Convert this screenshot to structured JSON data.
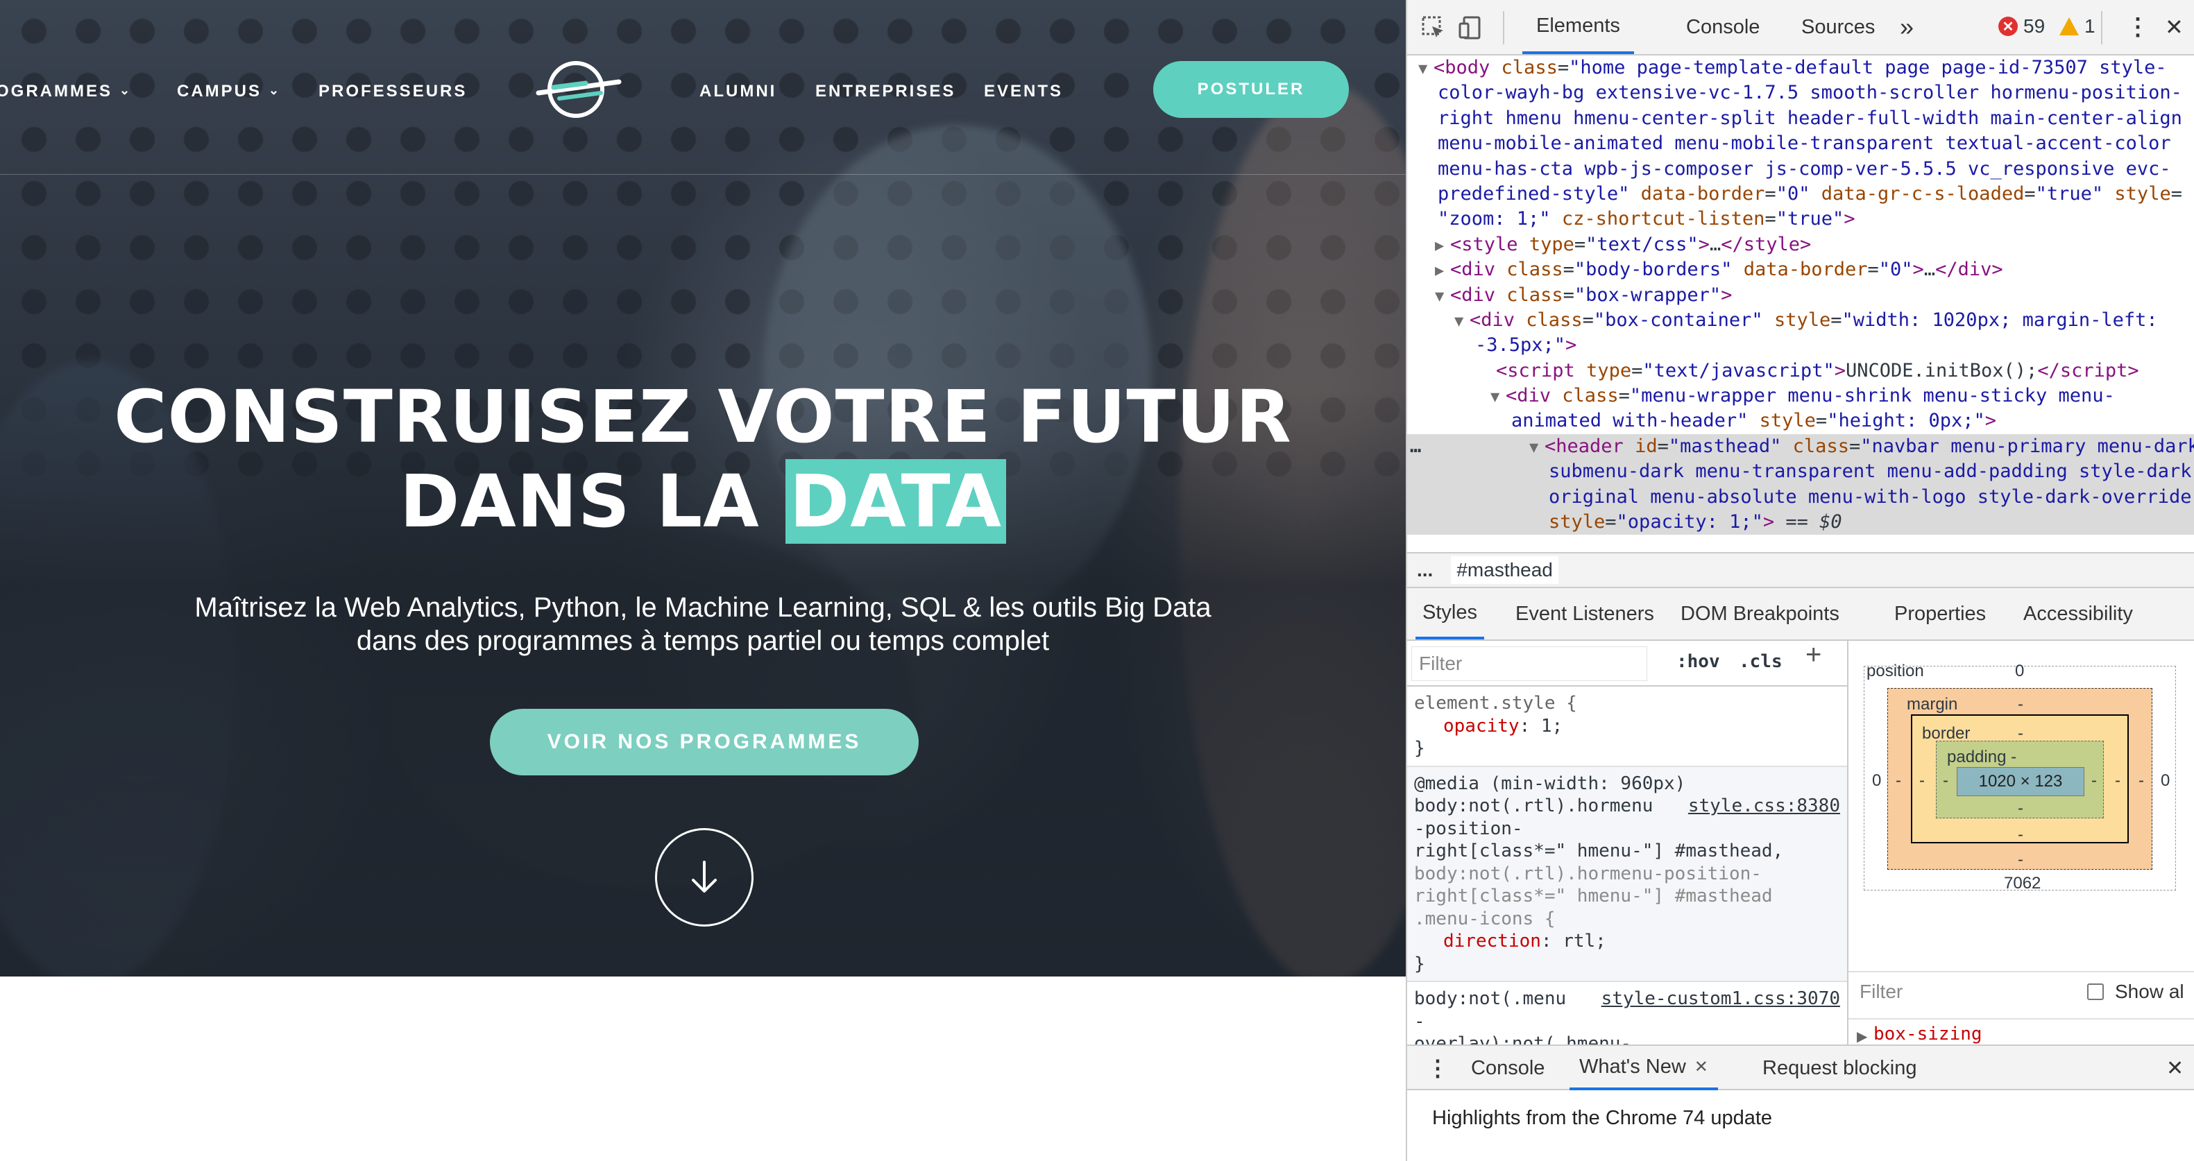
{
  "site": {
    "nav": {
      "items_left": [
        {
          "label": "OGRAMMES",
          "has_dropdown": true
        },
        {
          "label": "CAMPUS",
          "has_dropdown": true
        },
        {
          "label": "PROFESSEURS",
          "has_dropdown": false
        }
      ],
      "items_right": [
        {
          "label": "ALUMNI"
        },
        {
          "label": "ENTREPRISES"
        },
        {
          "label": "EVENTS"
        }
      ],
      "apply_label": "POSTULER",
      "chevron": "⌄"
    },
    "hero": {
      "title_line1": "CONSTRUISEZ VOTRE FUTUR",
      "title_line2_prefix": "DANS LA ",
      "title_line2_highlight": "DATA",
      "subtitle_line1": "Maîtrisez la Web Analytics, Python, le Machine Learning, SQL & les outils Big Data",
      "subtitle_line2": "dans des programmes à temps partiel ou temps complet",
      "cta_label": "VOIR NOS PROGRAMMES"
    },
    "colors": {
      "accent": "#5ed0c0",
      "cta": "#7dcfc0"
    }
  },
  "devtools": {
    "tabs": [
      "Elements",
      "Console",
      "Sources"
    ],
    "more_tabs": "»",
    "errors": "59",
    "warnings": "1",
    "error_icon": "✕",
    "menu_icon": "⋮",
    "close_icon": "✕",
    "dom_lines": [
      {
        "tri": "▼",
        "html": "<span class='tg'>&lt;body</span> <span class='an'>class</span>=<span class='av'>\"home page-template-default page page-id-73507 style-</span>"
      },
      {
        "tri": "",
        "html": "<span class='av'>color-wayh-bg extensive-vc-1.7.5 smooth-scroller hormenu-position-</span>"
      },
      {
        "tri": "",
        "html": "<span class='av'>right hmenu hmenu-center-split header-full-width main-center-align</span>"
      },
      {
        "tri": "",
        "html": "<span class='av'>menu-mobile-animated menu-mobile-transparent textual-accent-color</span>"
      },
      {
        "tri": "",
        "html": "<span class='av'>menu-has-cta wpb-js-composer js-comp-ver-5.5.5 vc_responsive evc-</span>"
      },
      {
        "tri": "",
        "html": "<span class='av'>predefined-style\"</span> <span class='an'>data-border</span>=<span class='av'>\"0\"</span> <span class='an'>data-gr-c-s-loaded</span>=<span class='av'>\"true\"</span> <span class='an'>style</span>=</span>"
      },
      {
        "tri": "",
        "html": "<span class='av'>\"zoom: 1;\"</span> <span class='an'>cz-shortcut-listen</span>=<span class='av'>\"true\"</span><span class='tg'>&gt;</span>"
      },
      {
        "tri": "▶",
        "html": "<span class='tg'>&lt;style</span> <span class='an'>type</span>=<span class='av'>\"text/css\"</span><span class='tg'>&gt;</span>…<span class='tg'>&lt;/style&gt;</span>"
      },
      {
        "tri": "▶",
        "html": "<span class='tg'>&lt;div</span> <span class='an'>class</span>=<span class='av'>\"body-borders\"</span> <span class='an'>data-border</span>=<span class='av'>\"0\"</span><span class='tg'>&gt;</span>…<span class='tg'>&lt;/div&gt;</span>"
      },
      {
        "tri": "▼",
        "html": "<span class='tg'>&lt;div</span> <span class='an'>class</span>=<span class='av'>\"box-wrapper\"</span><span class='tg'>&gt;</span>"
      },
      {
        "tri": "▼",
        "html": "<span class='tg'>&lt;div</span> <span class='an'>class</span>=<span class='av'>\"box-container\"</span> <span class='an'>style</span>=<span class='av'>\"width: 1020px; margin-left:</span>"
      },
      {
        "tri": "",
        "html": "<span class='av'>-3.5px;\"</span><span class='tg'>&gt;</span>"
      },
      {
        "tri": "",
        "html": "<span class='tg'>&lt;script</span> <span class='an'>type</span>=<span class='av'>\"text/javascript\"</span><span class='tg'>&gt;</span>UNCODE.initBox();<span class='tg'>&lt;/script&gt;</span>"
      },
      {
        "tri": "▼",
        "html": "<span class='tg'>&lt;div</span> <span class='an'>class</span>=<span class='av'>\"menu-wrapper menu-shrink menu-sticky menu-</span>"
      },
      {
        "tri": "",
        "html": "<span class='av'>animated with-header\"</span> <span class='an'>style</span>=<span class='av'>\"height: 0px;\"</span><span class='tg'>&gt;</span>"
      },
      {
        "tri": "▼",
        "html": "<span class='tg'>&lt;header</span> <span class='an'>id</span>=<span class='av'>\"masthead\"</span> <span class='an'>class</span>=<span class='av'>\"navbar menu-primary menu-dark</span>"
      },
      {
        "tri": "",
        "html": "<span class='av'>submenu-dark menu-transparent menu-add-padding style-dark-</span>"
      },
      {
        "tri": "",
        "html": "<span class='av'>original menu-absolute menu-with-logo style-dark-override\"</span>"
      },
      {
        "tri": "",
        "html": "<span class='an'>style</span>=<span class='av'>\"opacity: 1;\"</span><span class='tg'>&gt;</span> == <i>$0</i>"
      }
    ],
    "breadcrumb": {
      "dots": "...",
      "item": "#masthead"
    },
    "subtabs": [
      "Styles",
      "Event Listeners",
      "DOM Breakpoints",
      "Properties",
      "Accessibility"
    ],
    "filter_placeholder": "Filter",
    "hov": ":hov",
    "cls": ".cls",
    "plus": "+",
    "rules": {
      "element_style_selector": "element.style {",
      "element_style_prop": "opacity",
      "element_style_val": "1;",
      "close_brace": "}",
      "media_query": "@media (min-width: 960px)",
      "rule2_selector_l1": "body:not(.rtl).hormenu",
      "rule2_source": "style.css:8380",
      "rule2_selector_l2": "-position-",
      "rule2_selector_l3": "right[class*=\" hmenu-\"] #masthead,",
      "rule2_selector_l4": "body:not(.rtl).hormenu-position-",
      "rule2_selector_l5": "right[class*=\" hmenu-\"] #masthead",
      "rule2_selector_l6": ".menu-icons {",
      "rule2_prop": "direction",
      "rule2_val": "rtl;",
      "rule3_selector": "body:not(.menu",
      "rule3_source": "style-custom1.css:3070",
      "rule3_cont": "-",
      "rule3_cont2": "overlay):not(.hmenu-"
    },
    "box_model": {
      "position_label": "position",
      "position_val": "0",
      "margin_label": "margin",
      "border_label": "border",
      "padding_label": "padding -",
      "content": "1020 × 123",
      "dash": "-",
      "left_val": "0",
      "right_val": "0",
      "bottom_val": "7062"
    },
    "computed_filter": "Filter",
    "show_all": "Show al",
    "computed_prop": "box-sizing",
    "drawer_tabs": [
      "Console",
      "What's New",
      "Request blocking"
    ],
    "drawer_content": "Highlights from the Chrome 74 update"
  }
}
